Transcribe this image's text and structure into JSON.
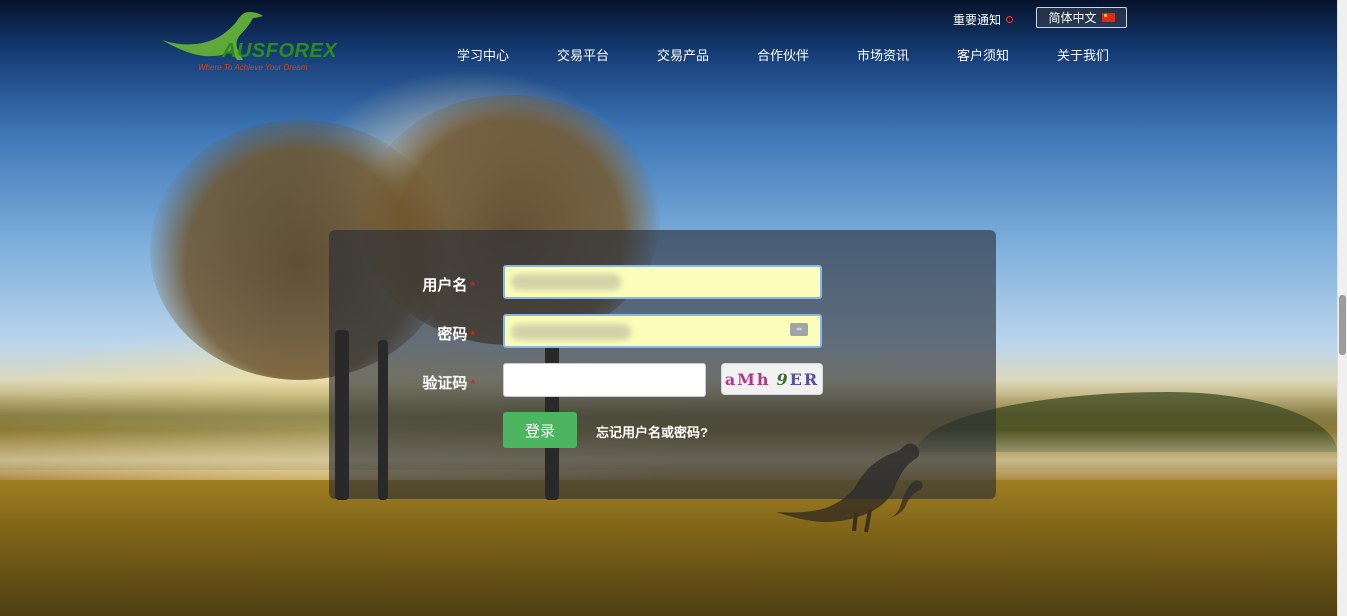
{
  "header": {
    "logo": {
      "brand": "AUSFOREX",
      "slogan": "Where To Achieve Your Dream"
    },
    "notice_label": "重要通知",
    "language_label": "简体中文",
    "nav": [
      {
        "label": "学习中心"
      },
      {
        "label": "交易平台"
      },
      {
        "label": "交易产品"
      },
      {
        "label": "合作伙伴"
      },
      {
        "label": "市场资讯"
      },
      {
        "label": "客户须知"
      },
      {
        "label": "关于我们"
      }
    ]
  },
  "login": {
    "username_label": "用户名",
    "password_label": "密码",
    "captcha_label": "验证码",
    "required_mark": "*",
    "captcha_text_1": "aMh",
    "captcha_text_2": "9",
    "captcha_text_3": "ER",
    "submit_label": "登录",
    "forgot_label": "忘记用户名或密码?"
  },
  "colors": {
    "accent_green": "#4cb560",
    "autofill_yellow": "#fbfdb8",
    "required_red": "#e02020"
  },
  "icons": [
    "kangaroo-logo-icon",
    "notice-dot-icon",
    "china-flag-icon",
    "keyboard-icon"
  ]
}
